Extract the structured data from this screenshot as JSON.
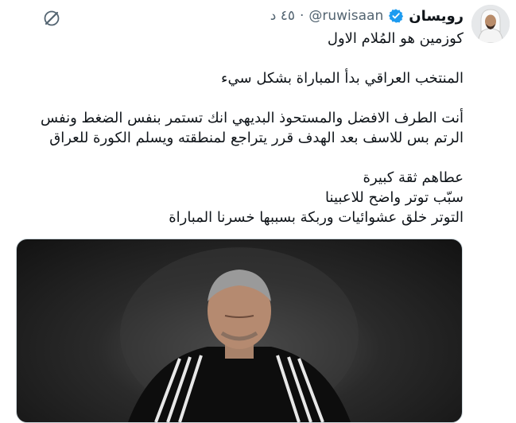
{
  "user": {
    "display_name": "رويسان",
    "handle": "@ruwisaan",
    "separator": "·",
    "time": "٤٥ د"
  },
  "tweet": {
    "lines": [
      "كوزمين هو المُلام الاول",
      "المنتخب العراقي بدأ المباراة بشكل سيء",
      "أنت الطرف الافضل والمستحوذ البديهي انك تستمر بنفس الضغط ونفس",
      "الرتم بس للاسف بعد الهدف قرر يتراجع لمنطقته ويسلم الكورة للعراق",
      "عطاهم ثقة كبيرة",
      "سبّب توتر واضح للاعبينا",
      "التوتر خلق عشوائيات وربكة بسببها خسرنا المباراة"
    ]
  },
  "icons": {
    "verified": "verified-badge-icon",
    "grok": "grok-icon"
  },
  "colors": {
    "verified": "#1d9bf0",
    "secondary_text": "#536471"
  }
}
